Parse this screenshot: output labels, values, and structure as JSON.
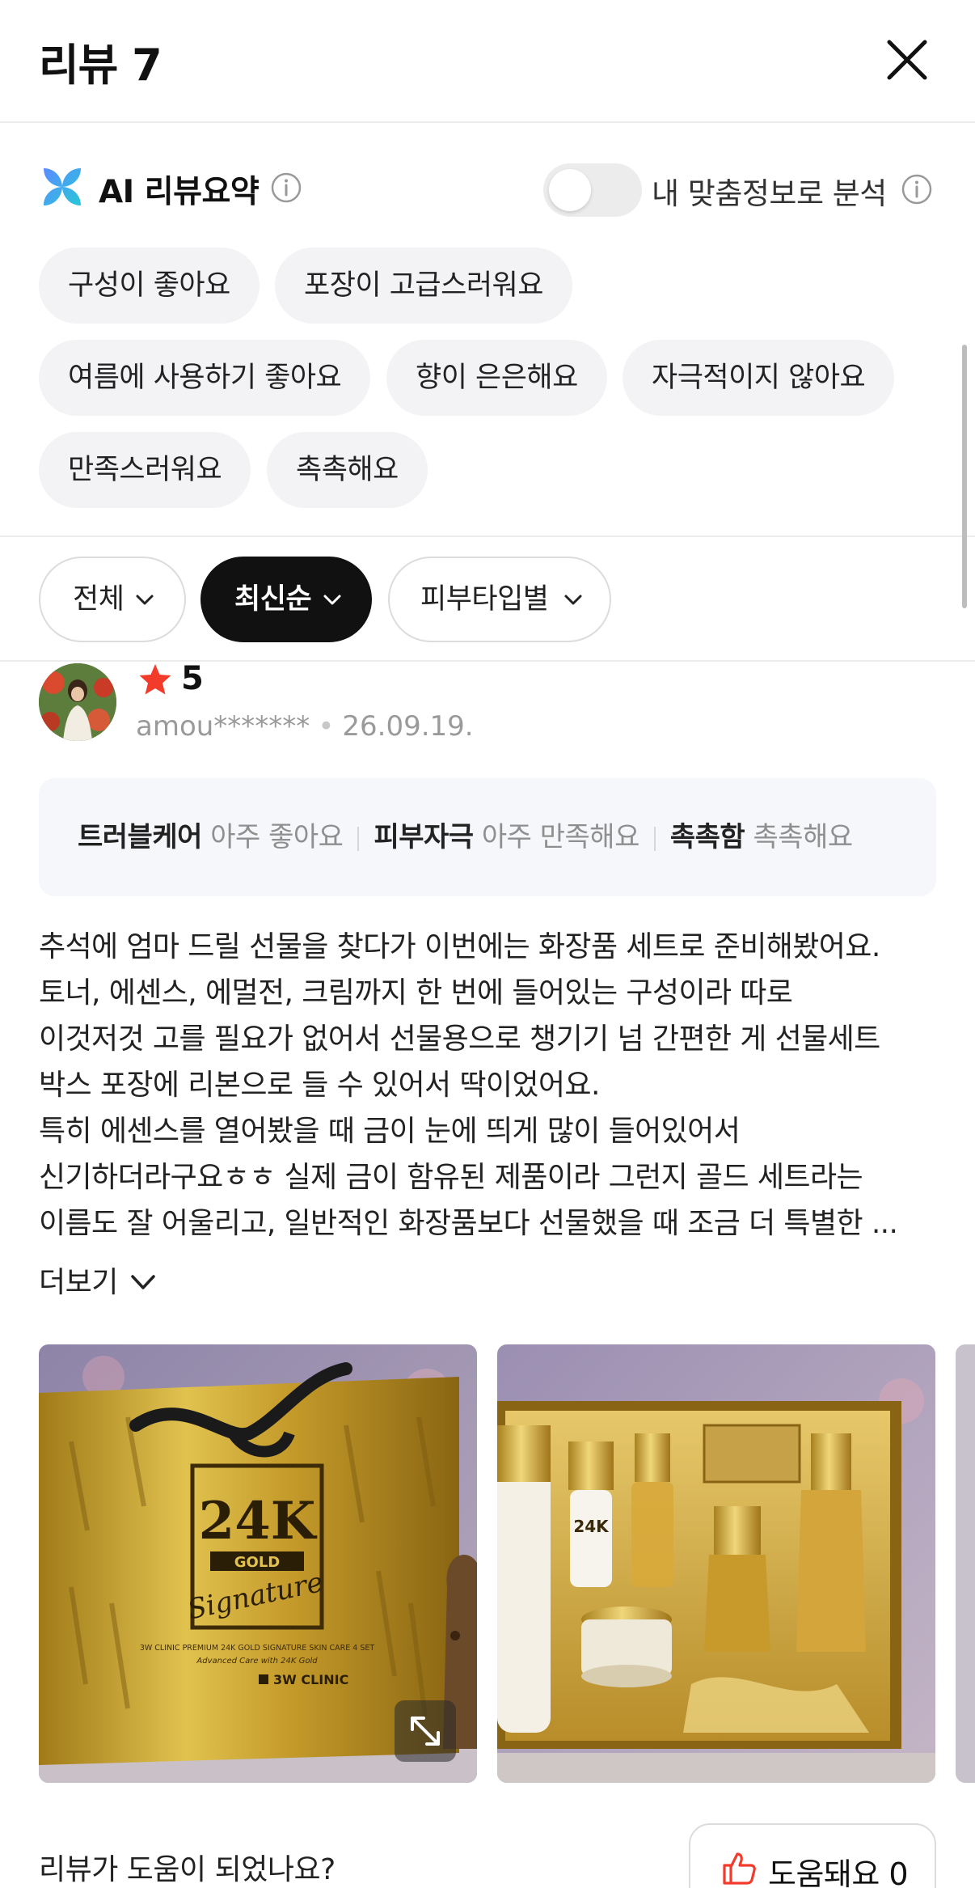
{
  "header": {
    "title": "리뷰 7"
  },
  "ai_summary": {
    "title": "AI 리뷰요약",
    "toggle_label": "내 맞춤정보로 분석",
    "toggle_on": false,
    "tags": [
      "구성이 좋아요",
      "포장이 고급스러워요",
      "여름에 사용하기 좋아요",
      "향이 은은해요",
      "자극적이지 않아요",
      "만족스러워요",
      "촉촉해요"
    ]
  },
  "filters": [
    {
      "label": "전체",
      "active": false
    },
    {
      "label": "최신순",
      "active": true
    },
    {
      "label": "피부타입별",
      "active": false
    }
  ],
  "review": {
    "rating": "5",
    "username": "amou*******",
    "date": "26.09.19.",
    "attributes": [
      {
        "key": "트러블케어",
        "value": "아주 좋아요"
      },
      {
        "key": "피부자극",
        "value": "아주 만족해요"
      },
      {
        "key": "촉촉함",
        "value": "촉촉해요"
      }
    ],
    "lines": [
      "추석에 엄마 드릴 선물을 찾다가 이번에는 화장품 세트로 준비해봤어요.",
      "토너, 에센스, 에멀전, 크림까지 한 번에 들어있는 구성이라 따로",
      "이것저것 고를 필요가 없어서 선물용으로 챙기기 넘 간편한 게 선물세트",
      "박스 포장에 리본으로 들 수 있어서 딱이었어요.",
      "특히 에센스를 열어봤을 때 금이 눈에 띄게 많이 들어있어서",
      "신기하더라구요ㅎㅎ 실제 금이 함유된 제품이라 그런지 골드 세트라는",
      "이름도 잘 어울리고, 일반적인 화장품보다 선물했을 때 조금 더 특별한 ..."
    ],
    "more_label": "더보기",
    "photo_texts": {
      "box_logo": "24K",
      "box_gold": "GOLD",
      "box_signature": "Signature",
      "box_line": "3W CLINIC PREMIUM 24K GOLD SIGNATURE SKIN CARE 4 SET",
      "box_sub": "Advanced Care with 24K Gold",
      "box_brand": "3W CLINIC",
      "set_label": "24K"
    }
  },
  "helpful": {
    "question": "리뷰가 도움이 되었나요?",
    "button_label": "도움돼요 0"
  },
  "colors": {
    "accent_star": "#f23b2a",
    "chip_bg": "#f3f3f5",
    "active_filter_bg": "#111111",
    "attr_box_bg": "#f6f7fb"
  }
}
